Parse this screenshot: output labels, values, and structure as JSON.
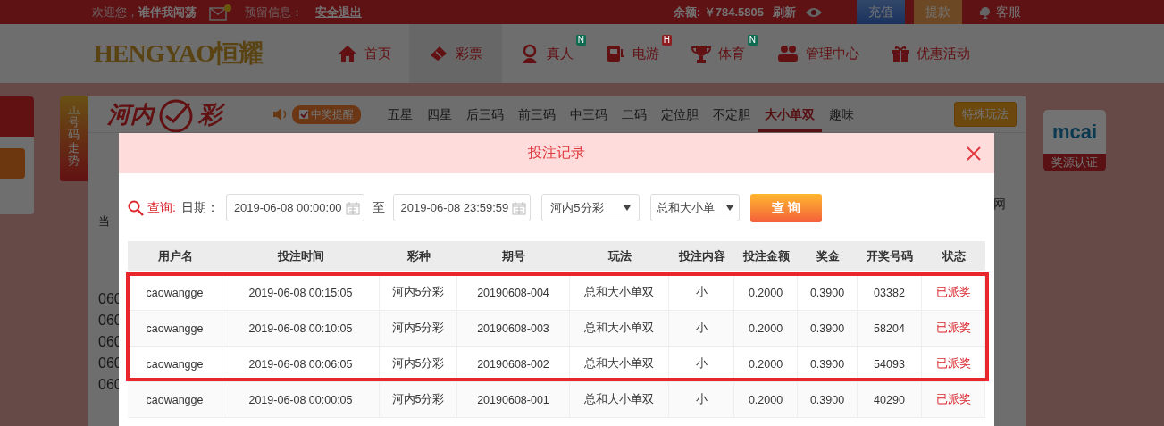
{
  "top_bar": {
    "welcome": "欢迎您，**谁伴我闯荡**",
    "mail_unread": true,
    "reserved_info": "预留信息：",
    "logout": "安全退出",
    "balance": "余额: ￥784.5805",
    "refresh": "刷新",
    "recharge": "充值",
    "withdraw": "提款",
    "support": "客服"
  },
  "logo": "HENGYAO恒耀",
  "nav": [
    {
      "label": "首页",
      "kind": "home",
      "selected": false
    },
    {
      "label": "彩票",
      "kind": "ticket",
      "selected": true
    },
    {
      "label": "真人",
      "kind": "dealer",
      "selected": false,
      "badge": "N",
      "color": "#0e6a4f"
    },
    {
      "label": "电游",
      "kind": "slot",
      "selected": false,
      "badge": "H",
      "color": "#8c1d20"
    },
    {
      "label": "体育",
      "kind": "trophy",
      "selected": false,
      "badge": "N",
      "color": "#0e6a4f"
    },
    {
      "label": "管理中心",
      "kind": "people",
      "selected": false
    },
    {
      "label": "优惠活动",
      "kind": "gift",
      "selected": false
    }
  ],
  "trend_tab": "号码走势",
  "lottery": {
    "logo_left": "河内",
    "logo_right": "彩",
    "win_alert": "中奖提醒",
    "win_alert_checked": true,
    "play_tabs": [
      {
        "label": "五星",
        "selected": false
      },
      {
        "label": "四星",
        "selected": false
      },
      {
        "label": "后三码",
        "selected": false
      },
      {
        "label": "前三码",
        "selected": false
      },
      {
        "label": "中三码",
        "selected": false
      },
      {
        "label": "二码",
        "selected": false
      },
      {
        "label": "定位胆",
        "selected": false
      },
      {
        "label": "不定胆",
        "selected": false
      },
      {
        "label": "大小单双",
        "selected": true
      },
      {
        "label": "趣味",
        "selected": false
      }
    ],
    "special_button": "特殊玩法",
    "current_label": "当",
    "draw_rows": [
      "060",
      "060",
      "060",
      "060",
      "060"
    ],
    "side_text": "网"
  },
  "certification": {
    "logo": "mcai",
    "label": "奖源认证"
  },
  "dialog": {
    "title": "投注记录",
    "query_label": "查询:",
    "date_label": "日期：",
    "start": "2019-06-08 00:00:00",
    "separator": "至",
    "end": "2019-06-08 23:59:59",
    "lottery_select": "河内5分彩",
    "play_select": "总和大小单",
    "search_button": "查 询",
    "columns": [
      "用户名",
      "投注时间",
      "彩种",
      "期号",
      "玩法",
      "投注内容",
      "投注金额",
      "奖金",
      "开奖号码",
      "状态"
    ],
    "rows": [
      {
        "highlighted": true,
        "cells": [
          "caowangge",
          "2019-06-08 00:15:05",
          "河内5分彩",
          "20190608-004",
          "总和大小单双",
          "小",
          "0.2000",
          "0.3900",
          "03382",
          "已派奖"
        ]
      },
      {
        "highlighted": true,
        "cells": [
          "caowangge",
          "2019-06-08 00:10:05",
          "河内5分彩",
          "20190608-003",
          "总和大小单双",
          "小",
          "0.2000",
          "0.3900",
          "58204",
          "已派奖"
        ]
      },
      {
        "highlighted": true,
        "cells": [
          "caowangge",
          "2019-06-08 00:06:05",
          "河内5分彩",
          "20190608-002",
          "总和大小单双",
          "小",
          "0.2000",
          "0.3900",
          "54093",
          "已派奖"
        ]
      },
      {
        "highlighted": false,
        "cells": [
          "caowangge",
          "2019-06-08 00:00:05",
          "河内5分彩",
          "20190608-001",
          "总和大小单双",
          "小",
          "0.2000",
          "0.3900",
          "40290",
          "已派奖"
        ]
      }
    ]
  }
}
